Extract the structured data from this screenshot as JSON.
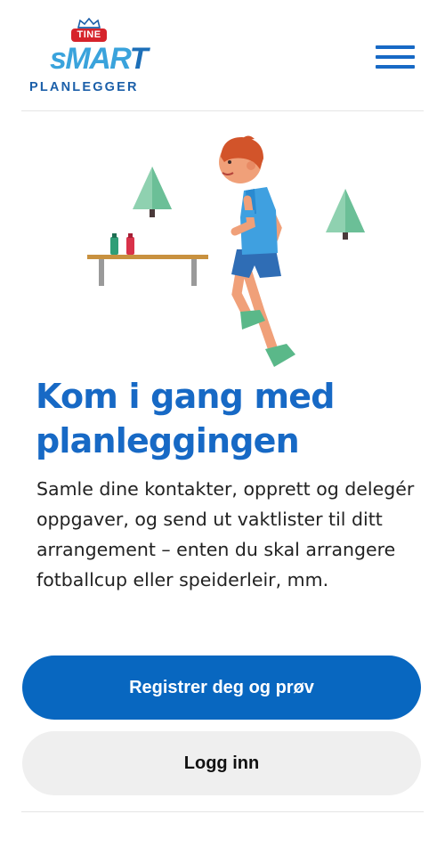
{
  "header": {
    "logo": {
      "brand": "TINE",
      "product": "sMARt",
      "subtitle": "PLANLEGGER"
    },
    "menu_icon": "hamburger-menu-icon"
  },
  "hero": {
    "illustration": "boy-running-with-trees-and-table",
    "title": "Kom i gang med planleggingen",
    "description": "Samle dine kontakter, opprett og delegér oppgaver, og send ut vaktlister til ditt arrangement – enten du skal arrangere fotballcup eller speiderleir, mm."
  },
  "actions": {
    "register_label": "Registrer deg og prøv",
    "login_label": "Logg inn"
  },
  "colors": {
    "primary": "#0867c0",
    "title": "#1769c5",
    "logo_light": "#3aa3dc",
    "logo_dark": "#1b5fa9",
    "tine_red": "#d6232b",
    "secondary_button": "#efefef"
  }
}
